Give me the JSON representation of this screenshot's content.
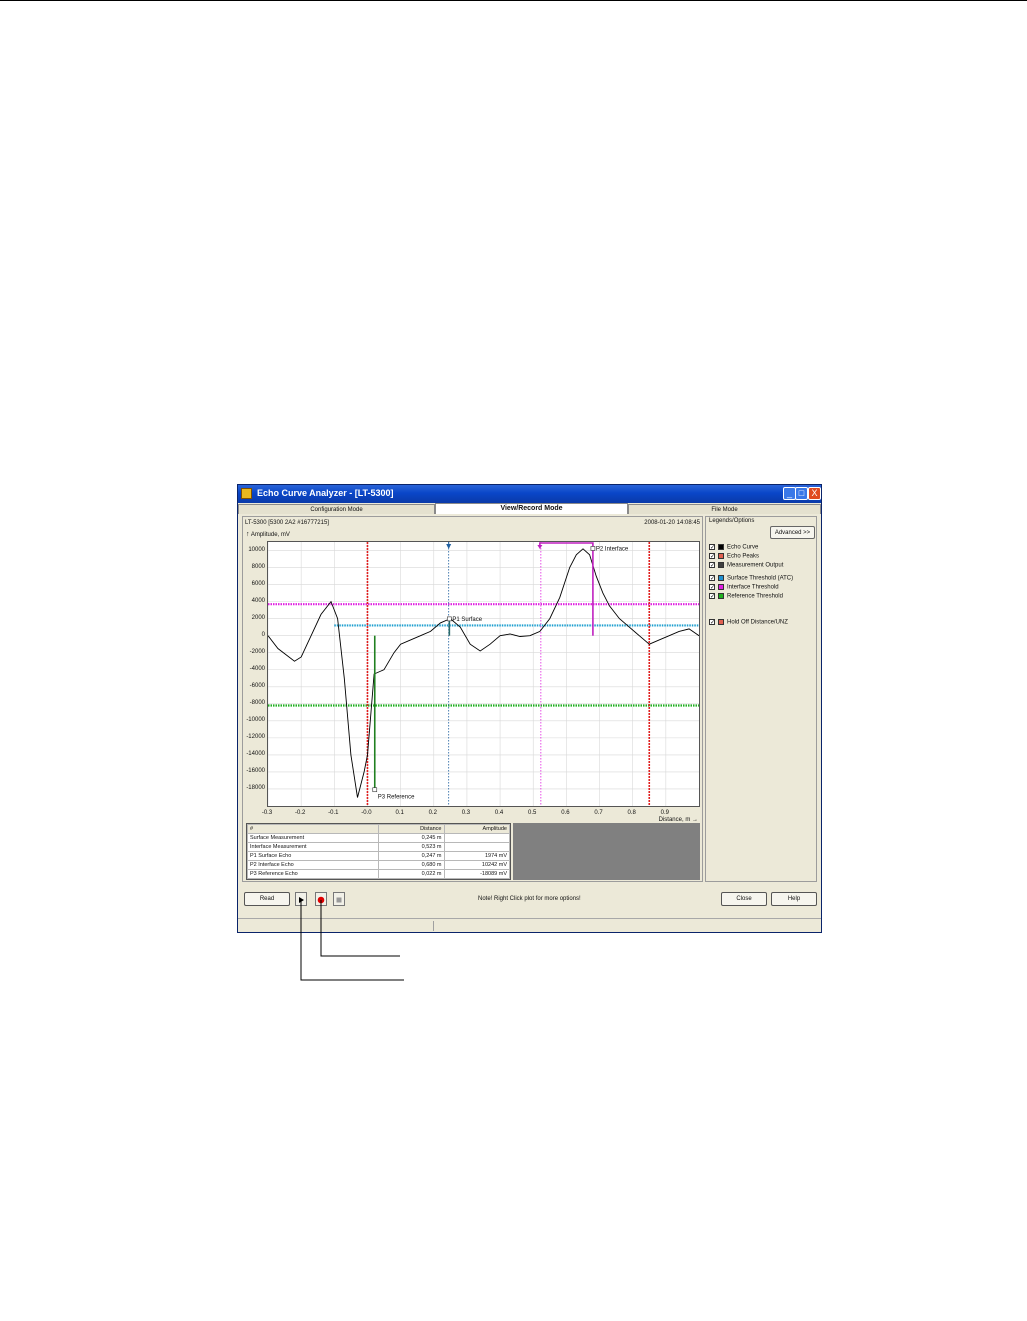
{
  "window": {
    "title": "Echo Curve Analyzer - [LT-5300]",
    "controls": [
      "_",
      "□",
      "X"
    ]
  },
  "tabs": [
    {
      "label": "Configuration Mode",
      "active": false
    },
    {
      "label": "View/Record Mode",
      "active": true
    },
    {
      "label": "File Mode",
      "active": false
    }
  ],
  "chart_header": {
    "device": "LT-5300 [5300 2A2 #16777215]",
    "timestamp": "2008-01-20 14:08:45"
  },
  "chart_data": {
    "type": "line",
    "ylabel": "Amplitude, mV",
    "xlabel": "Distance, m",
    "xlim": [
      -0.3,
      1.0
    ],
    "ylim": [
      -20000,
      11000
    ],
    "x_ticks": [
      "-0.3",
      "-0.2",
      "-0.1",
      "-0.0",
      "0.1",
      "0.2",
      "0.3",
      "0.4",
      "0.5",
      "0.6",
      "0.7",
      "0.8",
      "0.9"
    ],
    "y_ticks": [
      "10000",
      "8000",
      "6000",
      "4000",
      "2000",
      "0",
      "-2000",
      "-4000",
      "-6000",
      "-8000",
      "-10000",
      "-12000",
      "-14000",
      "-16000",
      "-18000"
    ],
    "echo_curve": {
      "color": "#000000",
      "x": [
        -0.3,
        -0.27,
        -0.22,
        -0.2,
        -0.17,
        -0.14,
        -0.11,
        -0.09,
        -0.07,
        -0.05,
        -0.03,
        -0.01,
        0.0,
        0.02,
        0.05,
        0.08,
        0.1,
        0.13,
        0.16,
        0.19,
        0.22,
        0.25,
        0.28,
        0.31,
        0.34,
        0.37,
        0.4,
        0.43,
        0.46,
        0.49,
        0.52,
        0.55,
        0.58,
        0.61,
        0.63,
        0.65,
        0.67,
        0.69,
        0.71,
        0.73,
        0.76,
        0.79,
        0.82,
        0.85,
        0.88,
        0.91,
        0.94,
        0.97,
        1.0
      ],
      "y": [
        0,
        -1500,
        -3000,
        -2500,
        0,
        2500,
        4000,
        2000,
        -5000,
        -14000,
        -19000,
        -16000,
        -14000,
        -4500,
        -4000,
        -2000,
        -1000,
        -500,
        0,
        500,
        1500,
        2000,
        1000,
        -1000,
        -1800,
        -1000,
        0,
        200,
        -100,
        0,
        500,
        2000,
        4500,
        8000,
        9500,
        10200,
        9500,
        7000,
        5000,
        3500,
        2000,
        1000,
        0,
        -1000,
        -500,
        0,
        500,
        800,
        0
      ]
    },
    "thresholds": [
      {
        "name": "Interface Threshold",
        "color": "#e020e0",
        "y": 3700
      },
      {
        "name": "Surface Threshold (ATC)",
        "color": "#20a0d0",
        "y": 1200,
        "x_from": -0.1
      },
      {
        "name": "Reference Threshold",
        "color": "#20b020",
        "y": -8200
      }
    ],
    "hold_off_lines": [
      {
        "x": 0.0,
        "color": "#e02020"
      },
      {
        "x": 0.85,
        "color": "#e02020"
      }
    ],
    "measurement_lines": [
      {
        "name": "Surface Measurement",
        "x": 0.245,
        "color": "#2060a0"
      },
      {
        "name": "Interface Measurement",
        "x": 0.523,
        "color": "#e020e0"
      }
    ],
    "peaks": [
      {
        "label": "P1 Surface",
        "x": 0.247,
        "y": 1974,
        "color": "#2a6a6a"
      },
      {
        "label": "P2 Interface",
        "x": 0.68,
        "y": 10242,
        "color": "#c020c0"
      },
      {
        "label": "P3 Reference",
        "x": 0.022,
        "y": -18089,
        "color": "#208020"
      }
    ],
    "interface_bracket": {
      "x_from": 0.52,
      "x_to": 0.68,
      "color": "#c020c0"
    }
  },
  "table": {
    "headers": [
      "#",
      "Distance",
      "Amplitude"
    ],
    "rows": [
      {
        "name": "Surface Measurement",
        "distance": "0,245 m",
        "amplitude": ""
      },
      {
        "name": "Interface Measurement",
        "distance": "0,523 m",
        "amplitude": ""
      },
      {
        "name": "P1 Surface Echo",
        "distance": "0,247 m",
        "amplitude": "1974 mV"
      },
      {
        "name": "P2 Interface Echo",
        "distance": "0,680 m",
        "amplitude": "10242 mV"
      },
      {
        "name": "P3 Reference Echo",
        "distance": "0,022 m",
        "amplitude": "-18089 mV"
      }
    ]
  },
  "legend": {
    "title": "Legends/Options",
    "advanced_label": "Advanced >>",
    "items": [
      {
        "label": "Echo Curve",
        "color": "#000000",
        "checked": true
      },
      {
        "label": "Echo Peaks",
        "color": "#e06050",
        "checked": true
      },
      {
        "label": "Measurement Output",
        "color": "#404040",
        "checked": true
      },
      {
        "label": "Surface Threshold (ATC)",
        "color": "#2090d0",
        "checked": true
      },
      {
        "label": "Interface Threshold",
        "color": "#e020e0",
        "checked": true
      },
      {
        "label": "Reference Threshold",
        "color": "#20b020",
        "checked": true
      },
      {
        "label": "Hold Off Distance/UNZ",
        "color": "#e06050",
        "checked": true
      }
    ]
  },
  "bottom": {
    "read_label": "Read",
    "note": "Note! Right Click plot for more options!",
    "close_label": "Close",
    "help_label": "Help"
  }
}
